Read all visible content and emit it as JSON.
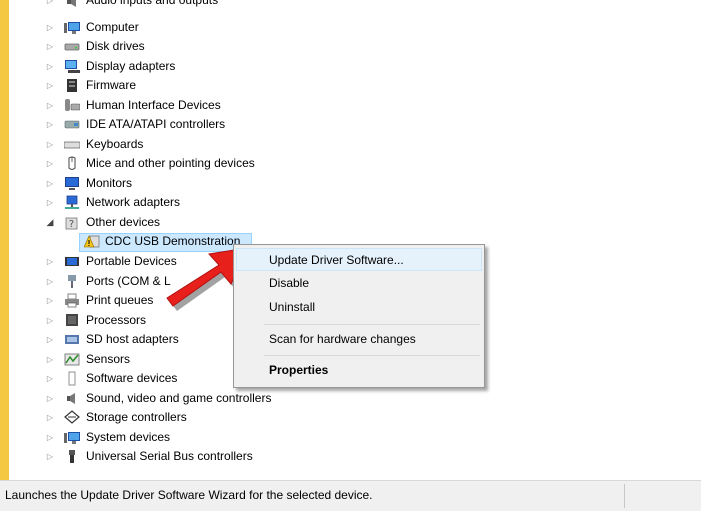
{
  "device_tree": {
    "categories": [
      {
        "label": "Audio inputs and outputs",
        "icon": "speaker-icon",
        "expanded": false
      },
      {
        "label": "Computer",
        "icon": "computer-icon",
        "expanded": false
      },
      {
        "label": "Disk drives",
        "icon": "disk-drive-icon",
        "expanded": false
      },
      {
        "label": "Display adapters",
        "icon": "display-adapter-icon",
        "expanded": false
      },
      {
        "label": "Firmware",
        "icon": "firmware-icon",
        "expanded": false
      },
      {
        "label": "Human Interface Devices",
        "icon": "hid-icon",
        "expanded": false
      },
      {
        "label": "IDE ATA/ATAPI controllers",
        "icon": "ide-controller-icon",
        "expanded": false
      },
      {
        "label": "Keyboards",
        "icon": "keyboard-icon",
        "expanded": false
      },
      {
        "label": "Mice and other pointing devices",
        "icon": "mouse-icon",
        "expanded": false
      },
      {
        "label": "Monitors",
        "icon": "monitor-icon",
        "expanded": false
      },
      {
        "label": "Network adapters",
        "icon": "network-adapter-icon",
        "expanded": false
      },
      {
        "label": "Other devices",
        "icon": "unknown-device-icon",
        "expanded": true
      },
      {
        "label": "Portable Devices",
        "icon": "portable-device-icon",
        "expanded": false
      },
      {
        "label": "Ports (COM & L",
        "icon": "port-icon",
        "expanded": false
      },
      {
        "label": "Print queues",
        "icon": "printer-icon",
        "expanded": false
      },
      {
        "label": "Processors",
        "icon": "processor-icon",
        "expanded": false
      },
      {
        "label": "SD host adapters",
        "icon": "sd-adapter-icon",
        "expanded": false
      },
      {
        "label": "Sensors",
        "icon": "sensor-icon",
        "expanded": false
      },
      {
        "label": "Software devices",
        "icon": "software-device-icon",
        "expanded": false
      },
      {
        "label": "Sound, video and game controllers",
        "icon": "speaker-icon",
        "expanded": false
      },
      {
        "label": "Storage controllers",
        "icon": "storage-controller-icon",
        "expanded": false
      },
      {
        "label": "System devices",
        "icon": "system-device-icon",
        "expanded": false
      },
      {
        "label": "Universal Serial Bus controllers",
        "icon": "usb-icon",
        "expanded": false
      }
    ],
    "selected_child": {
      "label": "CDC USB Demonstration",
      "icon": "warning-device-icon",
      "parent": "Other devices"
    }
  },
  "context_menu": {
    "items": [
      {
        "label": "Update Driver Software...",
        "highlighted": true
      },
      {
        "label": "Disable"
      },
      {
        "label": "Uninstall"
      },
      {
        "label": "Scan for hardware changes"
      },
      {
        "label": "Properties",
        "bold": true
      }
    ]
  },
  "status_bar": {
    "text": "Launches the Update Driver Software Wizard for the selected device."
  },
  "annotation": {
    "icon": "red-arrow-icon",
    "color": "#e8201c"
  },
  "colors": {
    "selection": "#cce8ff",
    "menu_highlight": "#e5f1fb",
    "left_strip": "#f4c842"
  }
}
